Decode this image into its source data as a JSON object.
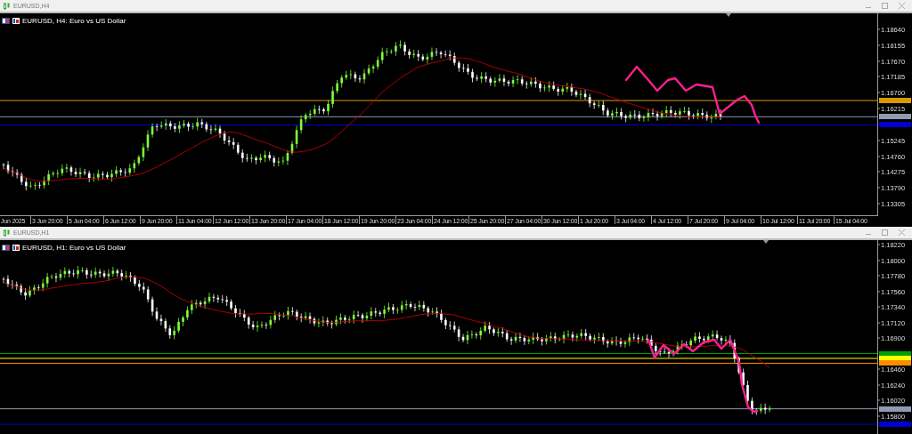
{
  "windows": [
    {
      "title": "EURUSD,H4",
      "chart_label": "EURUSD, H4:  Euro vs US Dollar",
      "kind": "h4",
      "price_labels": [
        "1.18640",
        "1.18155",
        "1.17670",
        "1.17185",
        "1.16700",
        "1.16215",
        "1.15245",
        "1.14760",
        "1.14275",
        "1.13790",
        "1.13305"
      ],
      "time_labels": [
        "Jun 2025",
        "3 Jun 20:00",
        "5 Jun 04:00",
        "6 Jun 12:00",
        "9 Jun 20:00",
        "11 Jun 04:00",
        "12 Jun 12:00",
        "13 Jun 20:00",
        "17 Jun 04:00",
        "18 Jun 12:00",
        "19 Jun 20:00",
        "23 Jun 04:00",
        "24 Jun 12:00",
        "25 Jun 20:00",
        "27 Jun 04:00",
        "30 Jun 12:00",
        "1 Jul 20:00",
        "3 Jul 04:00",
        "4 Jul 12:00",
        "7 Jul 20:00",
        "9 Jul 04:00",
        "10 Jul 12:00",
        "11 Jul 20:00",
        "15 Jul 04:00"
      ],
      "lines": [
        {
          "color": "#d99a00"
        },
        {
          "color": "#8d9cb0"
        },
        {
          "color": "#0000d0"
        }
      ]
    },
    {
      "title": "EURUSD,H1",
      "chart_label": "EURUSD, H1:  Euro vs US Dollar",
      "kind": "h1",
      "price_labels": [
        "1.18220",
        "1.18000",
        "1.17780",
        "1.17560",
        "1.17340",
        "1.17120",
        "1.16900",
        "1.16460",
        "1.16240",
        "1.16020",
        "1.15800"
      ],
      "lines": [
        {
          "color": "#00a000"
        },
        {
          "color": "#ffff00"
        },
        {
          "color": "#ff8c00"
        },
        {
          "color": "#8d9cb0"
        },
        {
          "color": "#0000d0"
        }
      ]
    }
  ]
}
